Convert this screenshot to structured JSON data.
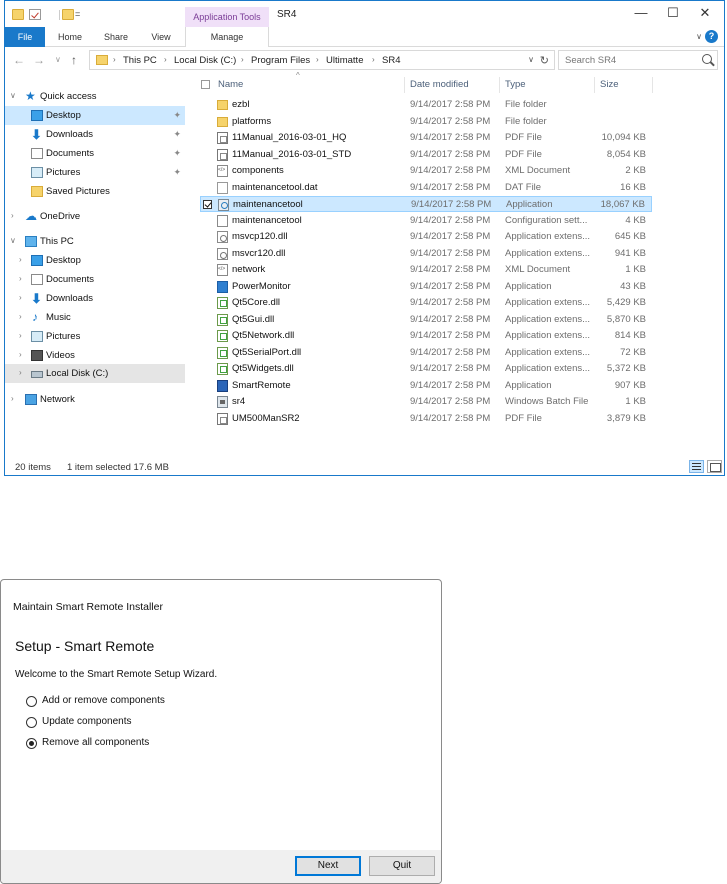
{
  "explorer": {
    "quick_access_dropdown": "=",
    "app_tools_label": "Application Tools",
    "window_title": "SR4",
    "controls": {
      "minimize": "—",
      "maximize": "☐",
      "close": "✕"
    },
    "ribbon_tabs": [
      "File",
      "Home",
      "Share",
      "View",
      "Manage"
    ],
    "ribbon_chevron": "∨",
    "help": "?",
    "nav_buttons": {
      "back": "←",
      "forward": "→",
      "recent": "∨",
      "up": "↑"
    },
    "breadcrumbs": [
      "This PC",
      "Local Disk (C:)",
      "Program Files",
      "Ultimatte",
      "SR4"
    ],
    "crumb_separator": "›",
    "address_dropdown": "∨",
    "refresh": "↻",
    "search_placeholder": "Search SR4",
    "nav_pane": [
      {
        "label": "Quick access",
        "icon": "star-icon",
        "glyph": "★",
        "arrow": "∨"
      },
      {
        "label": "Desktop",
        "icon": "desktop-icon",
        "pinned": true
      },
      {
        "label": "Downloads",
        "icon": "download-icon",
        "glyph": "⬇",
        "pinned": true
      },
      {
        "label": "Documents",
        "icon": "documents-icon",
        "pinned": true
      },
      {
        "label": "Pictures",
        "icon": "pictures-icon",
        "pinned": true
      },
      {
        "label": "Saved Pictures",
        "icon": "folder-icon"
      },
      {
        "label": "OneDrive",
        "icon": "onedrive-icon",
        "glyph": "☁",
        "arrow": "›"
      },
      {
        "label": "This PC",
        "icon": "computer-icon",
        "arrow": "∨"
      },
      {
        "label": "Desktop",
        "icon": "desktop-icon",
        "arrow": "›"
      },
      {
        "label": "Documents",
        "icon": "documents-icon",
        "arrow": "›"
      },
      {
        "label": "Downloads",
        "icon": "download-icon",
        "glyph": "⬇",
        "arrow": "›"
      },
      {
        "label": "Music",
        "icon": "music-icon",
        "glyph": "♪",
        "arrow": "›"
      },
      {
        "label": "Pictures",
        "icon": "pictures-icon",
        "arrow": "›"
      },
      {
        "label": "Videos",
        "icon": "videos-icon",
        "arrow": "›"
      },
      {
        "label": "Local Disk (C:)",
        "icon": "disk-icon",
        "arrow": "›"
      },
      {
        "label": "Network",
        "icon": "network-icon",
        "arrow": "›"
      }
    ],
    "pin_glyph": "✦",
    "sort_arrow": "^",
    "columns": {
      "name": "Name",
      "date": "Date modified",
      "type": "Type",
      "size": "Size"
    },
    "files": [
      {
        "name": "ezbl",
        "date": "9/14/2017 2:58 PM",
        "type": "File folder",
        "size": "",
        "kind": "folder"
      },
      {
        "name": "platforms",
        "date": "9/14/2017 2:58 PM",
        "type": "File folder",
        "size": "",
        "kind": "folder"
      },
      {
        "name": "11Manual_2016-03-01_HQ",
        "date": "9/14/2017 2:58 PM",
        "type": "PDF File",
        "size": "10,094 KB",
        "kind": "pdf"
      },
      {
        "name": "11Manual_2016-03-01_STD",
        "date": "9/14/2017 2:58 PM",
        "type": "PDF File",
        "size": "8,054 KB",
        "kind": "pdf"
      },
      {
        "name": "components",
        "date": "9/14/2017 2:58 PM",
        "type": "XML Document",
        "size": "2 KB",
        "kind": "xml"
      },
      {
        "name": "maintenancetool.dat",
        "date": "9/14/2017 2:58 PM",
        "type": "DAT File",
        "size": "16 KB",
        "kind": "dat"
      },
      {
        "name": "maintenancetool",
        "date": "9/14/2017 2:58 PM",
        "type": "Application",
        "size": "18,067 KB",
        "kind": "app",
        "selected": true
      },
      {
        "name": "maintenancetool",
        "date": "9/14/2017 2:58 PM",
        "type": "Configuration sett...",
        "size": "4 KB",
        "kind": "cfg"
      },
      {
        "name": "msvcp120.dll",
        "date": "9/14/2017 2:58 PM",
        "type": "Application extens...",
        "size": "645 KB",
        "kind": "dll"
      },
      {
        "name": "msvcr120.dll",
        "date": "9/14/2017 2:58 PM",
        "type": "Application extens...",
        "size": "941 KB",
        "kind": "dll"
      },
      {
        "name": "network",
        "date": "9/14/2017 2:58 PM",
        "type": "XML Document",
        "size": "1 KB",
        "kind": "xml"
      },
      {
        "name": "PowerMonitor",
        "date": "9/14/2017 2:58 PM",
        "type": "Application",
        "size": "43 KB",
        "kind": "pm"
      },
      {
        "name": "Qt5Core.dll",
        "date": "9/14/2017 2:58 PM",
        "type": "Application extens...",
        "size": "5,429 KB",
        "kind": "qt"
      },
      {
        "name": "Qt5Gui.dll",
        "date": "9/14/2017 2:58 PM",
        "type": "Application extens...",
        "size": "5,870 KB",
        "kind": "qt"
      },
      {
        "name": "Qt5Network.dll",
        "date": "9/14/2017 2:58 PM",
        "type": "Application extens...",
        "size": "814 KB",
        "kind": "qt"
      },
      {
        "name": "Qt5SerialPort.dll",
        "date": "9/14/2017 2:58 PM",
        "type": "Application extens...",
        "size": "72 KB",
        "kind": "qt"
      },
      {
        "name": "Qt5Widgets.dll",
        "date": "9/14/2017 2:58 PM",
        "type": "Application extens...",
        "size": "5,372 KB",
        "kind": "qt"
      },
      {
        "name": "SmartRemote",
        "date": "9/14/2017 2:58 PM",
        "type": "Application",
        "size": "907 KB",
        "kind": "smart"
      },
      {
        "name": "sr4",
        "date": "9/14/2017 2:58 PM",
        "type": "Windows Batch File",
        "size": "1 KB",
        "kind": "bat"
      },
      {
        "name": "UM500ManSR2",
        "date": "9/14/2017 2:58 PM",
        "type": "PDF File",
        "size": "3,879 KB",
        "kind": "pdf"
      }
    ],
    "status": {
      "count": "20 items",
      "selection": "1 item selected  17.6 MB"
    }
  },
  "installer": {
    "title": "Maintain Smart Remote Installer",
    "heading": "Setup - Smart Remote",
    "welcome": "Welcome to the Smart Remote Setup Wizard.",
    "options": [
      {
        "label": "Add or remove components",
        "checked": false
      },
      {
        "label": "Update components",
        "checked": false
      },
      {
        "label": "Remove all components",
        "checked": true
      }
    ],
    "next_label": "Next",
    "quit_label": "Quit"
  },
  "colors": {
    "accent": "#1979ca",
    "selection": "#cce8ff",
    "app_tools": "#7a3b96"
  }
}
